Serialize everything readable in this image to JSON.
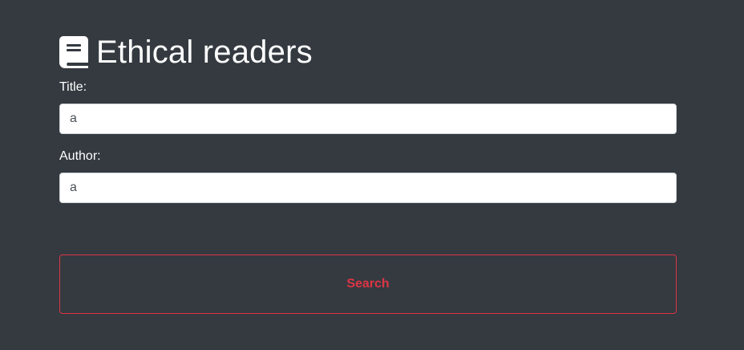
{
  "header": {
    "icon": "book-icon",
    "title": "Ethical readers"
  },
  "form": {
    "title_label": "Title:",
    "title_value": "a",
    "author_label": "Author:",
    "author_value": "a",
    "search_label": "Search"
  },
  "colors": {
    "background": "#343a40",
    "accent": "#dc3545",
    "text": "#ffffff",
    "input_bg": "#ffffff"
  }
}
